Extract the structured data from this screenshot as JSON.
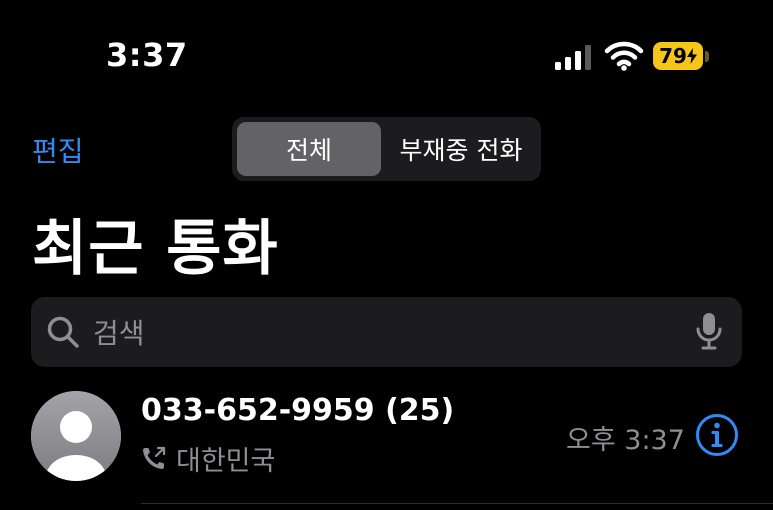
{
  "status_bar": {
    "time": "3:37",
    "battery_level": "79",
    "icons": [
      "cellular-signal-icon",
      "wifi-icon",
      "battery-charging-icon"
    ]
  },
  "header": {
    "edit_label": "편집",
    "segments": [
      "전체",
      "부재중 전화"
    ],
    "selected_segment": "전체",
    "title": "최근 통화"
  },
  "search": {
    "placeholder": "검색",
    "value": ""
  },
  "calls": [
    {
      "number": "033-652-9959 (25)",
      "location": "대한민국",
      "time": "오후 3:37",
      "call_type_icon": "outgoing-call-icon"
    }
  ],
  "colors": {
    "accent": "#2f8cf7",
    "background": "#000000",
    "secondary_text": "#8e8e93",
    "battery": "#f5c518"
  }
}
